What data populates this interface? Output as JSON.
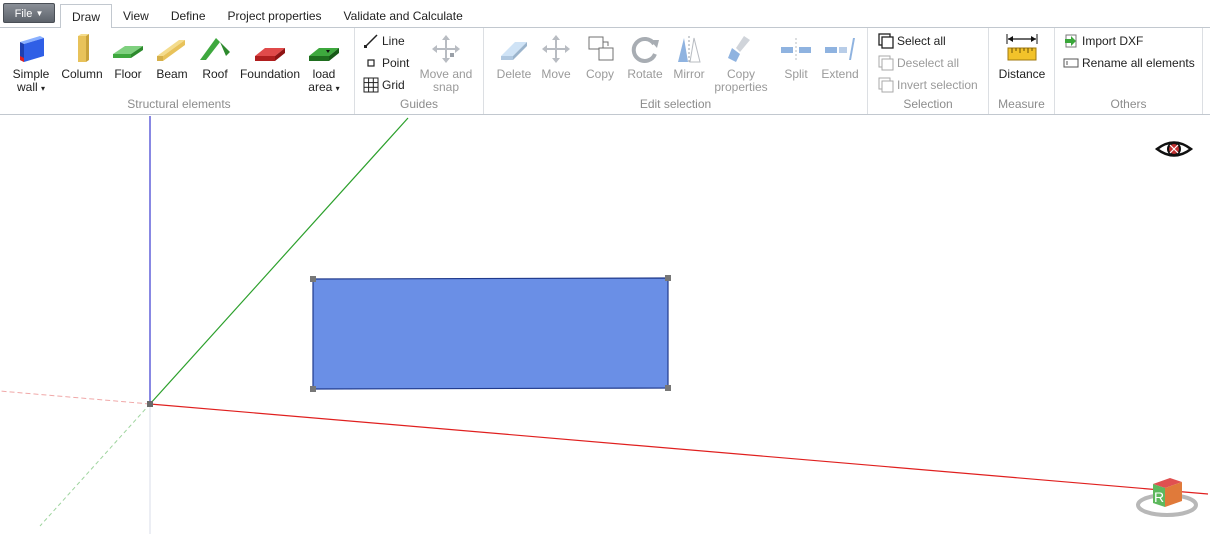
{
  "menu": {
    "file_label": "File",
    "file_caret": "▼"
  },
  "tabs": [
    {
      "label": "Draw",
      "active": true
    },
    {
      "label": "View"
    },
    {
      "label": "Define"
    },
    {
      "label": "Project properties"
    },
    {
      "label": "Validate and Calculate"
    }
  ],
  "groups": {
    "structural": {
      "label": "Structural elements"
    },
    "guides": {
      "label": "Guides"
    },
    "edit": {
      "label": "Edit selection"
    },
    "selection": {
      "label": "Selection"
    },
    "measure": {
      "label": "Measure"
    },
    "others": {
      "label": "Others"
    }
  },
  "structural": {
    "simple_wall": {
      "line1": "Simple",
      "line2": "wall",
      "caret": "▾"
    },
    "column": "Column",
    "floor": "Floor",
    "beam": "Beam",
    "roof": "Roof",
    "foundation": "Foundation",
    "load_area": {
      "line1": "load",
      "line2": "area",
      "caret": "▾"
    }
  },
  "guides": {
    "line": "Line",
    "point": "Point",
    "grid": "Grid",
    "move_snap": {
      "line1": "Move and",
      "line2": "snap"
    }
  },
  "edit": {
    "delete": "Delete",
    "move": "Move",
    "copy": "Copy",
    "rotate": "Rotate",
    "mirror": "Mirror",
    "copy_props": {
      "line1": "Copy",
      "line2": "properties"
    },
    "split": "Split",
    "extend": "Extend"
  },
  "selection": {
    "select_all": "Select all",
    "deselect_all": "Deselect all",
    "invert": "Invert selection"
  },
  "measure": {
    "distance": "Distance"
  },
  "others": {
    "import_dxf": "Import DXF",
    "rename_all": "Rename all elements"
  },
  "viewport": {
    "cube_letter": "R",
    "colors": {
      "x_axis": "#e0201f",
      "y_axis": "#2ca02c",
      "z_axis": "#3a3ad0",
      "element_fill": "#6a8fe6",
      "element_stroke": "#203a8c"
    }
  }
}
